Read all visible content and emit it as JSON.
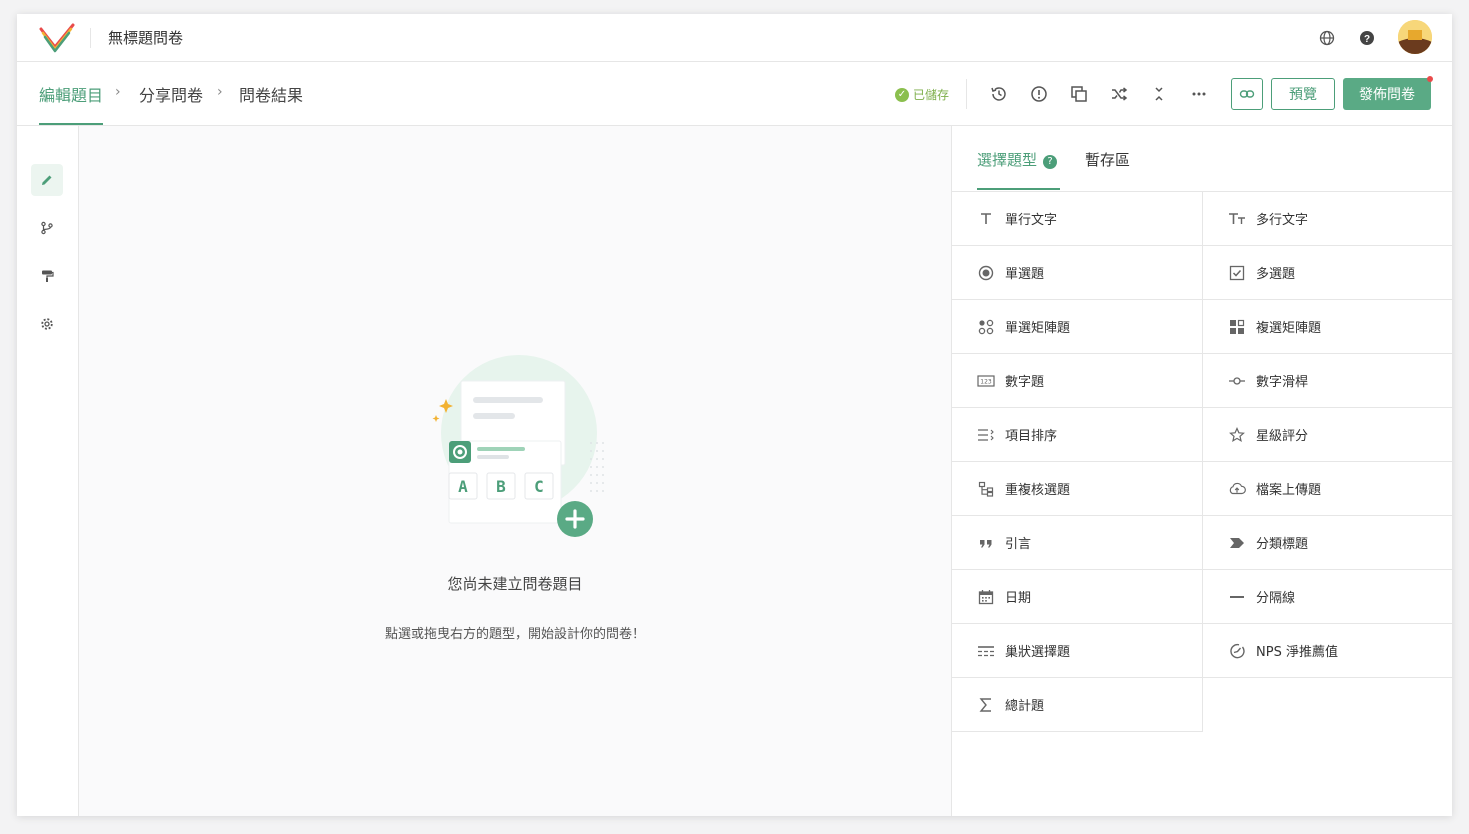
{
  "header": {
    "survey_title": "無標題問卷",
    "icons": [
      "logo-icon",
      "globe-icon",
      "help-icon",
      "avatar"
    ]
  },
  "nav": {
    "crumbs": [
      "編輯題目",
      "分享問卷",
      "問卷結果"
    ],
    "saved_label": "已儲存",
    "preview_label": "預覽",
    "publish_label": "發佈問卷",
    "toolbar_icons": [
      "history-icon",
      "alert-icon",
      "duplicate-icon",
      "shuffle-icon",
      "collapse-icon",
      "more-icon",
      "link-icon"
    ]
  },
  "rail": {
    "icons": [
      "pencil-icon",
      "branch-icon",
      "paint-roller-icon",
      "gear-icon"
    ]
  },
  "empty": {
    "title": "您尚未建立問卷題目",
    "subtitle": "點選或拖曳右方的題型，開始設計你的問卷！",
    "art_letters": [
      "A",
      "B",
      "C"
    ]
  },
  "panel": {
    "tabs": [
      "選擇題型",
      "暫存區"
    ],
    "help_glyph": "?",
    "question_types": [
      {
        "label": "單行文字",
        "icon": "text-icon"
      },
      {
        "label": "多行文字",
        "icon": "text-size-icon"
      },
      {
        "label": "單選題",
        "icon": "radio-icon"
      },
      {
        "label": "多選題",
        "icon": "checkbox-icon"
      },
      {
        "label": "單選矩陣題",
        "icon": "radio-matrix-icon"
      },
      {
        "label": "複選矩陣題",
        "icon": "checkbox-matrix-icon"
      },
      {
        "label": "數字題",
        "icon": "number-icon"
      },
      {
        "label": "數字滑桿",
        "icon": "slider-icon"
      },
      {
        "label": "項目排序",
        "icon": "sort-icon"
      },
      {
        "label": "星級評分",
        "icon": "star-icon"
      },
      {
        "label": "重複核選題",
        "icon": "hierarchy-icon"
      },
      {
        "label": "檔案上傳題",
        "icon": "cloud-upload-icon"
      },
      {
        "label": "引言",
        "icon": "quote-icon"
      },
      {
        "label": "分類標題",
        "icon": "tag-icon"
      },
      {
        "label": "日期",
        "icon": "calendar-icon"
      },
      {
        "label": "分隔線",
        "icon": "divider-icon"
      },
      {
        "label": "巢狀選擇題",
        "icon": "nested-select-icon"
      },
      {
        "label": "NPS 淨推薦值",
        "icon": "gauge-icon"
      },
      {
        "label": "總計題",
        "icon": "sigma-icon"
      }
    ]
  },
  "colors": {
    "accent": "#4c9e79",
    "publish_bg": "#5aaa85",
    "saved": "#7dae4a",
    "notify_dot": "#e94b4b"
  }
}
